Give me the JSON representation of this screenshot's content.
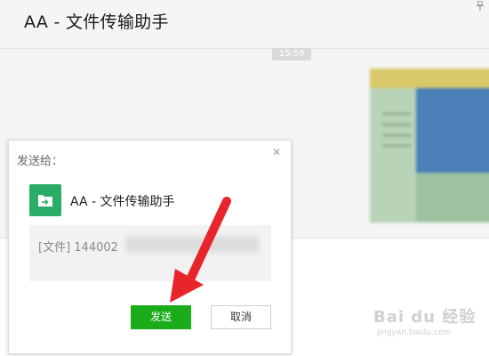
{
  "window": {
    "title": "AA - 文件传输助手",
    "pin_icon": "pin-icon"
  },
  "chat": {
    "timestamp": "15:59",
    "image_message": {
      "description_icon": "image-thumbnail",
      "blurred": true
    }
  },
  "dialog": {
    "title": "发送给：",
    "close_icon": "close-icon",
    "recipient": {
      "name": "AA - 文件传输助手",
      "avatar_icon": "file-transfer-icon",
      "avatar_color": "#2aae67"
    },
    "file_label": "[文件] 144002",
    "send_label": "发送",
    "cancel_label": "取消",
    "send_color": "#1aad19"
  },
  "annotation": {
    "arrow_color": "#e8252a"
  },
  "watermark": {
    "main": "Bai du 经验",
    "sub": "jingyan.baidu.com"
  }
}
